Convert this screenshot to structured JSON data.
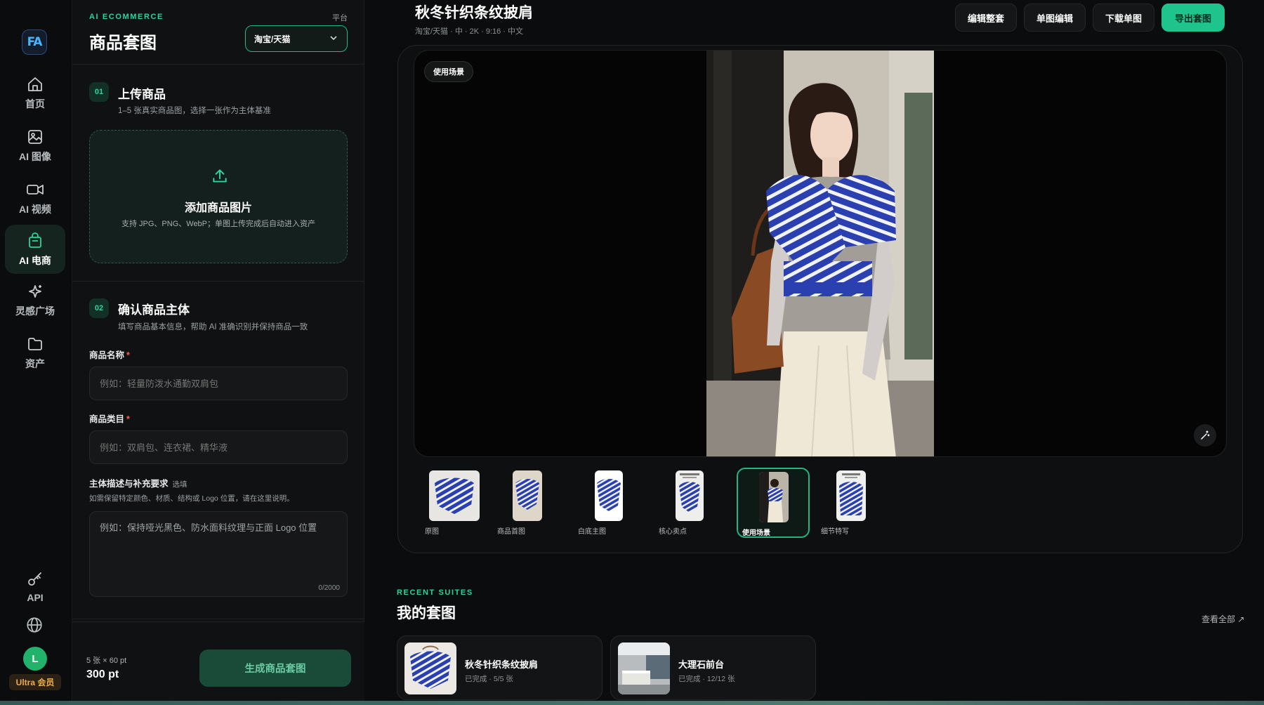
{
  "rail": {
    "items": [
      {
        "label": "首页",
        "icon": "home-icon"
      },
      {
        "label": "AI 图像",
        "icon": "image-icon"
      },
      {
        "label": "AI 视频",
        "icon": "video-icon"
      },
      {
        "label": "AI 电商",
        "icon": "shopping-bag-icon"
      },
      {
        "label": "灵感广场",
        "icon": "sparkles-icon"
      },
      {
        "label": "资产",
        "icon": "folder-icon"
      },
      {
        "label": "API",
        "icon": "key-icon"
      }
    ],
    "avatar_initial": "L",
    "membership": "Ultra 会员"
  },
  "panel": {
    "eyebrow": "AI ECOMMERCE",
    "title": "商品套图",
    "platform_label": "平台",
    "platform_value": "淘宝/天猫",
    "step1": {
      "num": "01",
      "title": "上传商品",
      "sub": "1–5 张真实商品图，选择一张作为主体基准",
      "drop_title": "添加商品图片",
      "drop_sub": "支持 JPG、PNG、WebP；单图上传完成后自动进入资产"
    },
    "step2": {
      "num": "02",
      "title": "确认商品主体",
      "sub": "填写商品基本信息，帮助 AI 准确识别并保持商品一致",
      "name_label": "商品名称",
      "name_placeholder": "例如：轻量防泼水通勤双肩包",
      "category_label": "商品类目",
      "category_placeholder": "例如：双肩包、连衣裙、精华液",
      "desc_label": "主体描述与补充要求",
      "desc_optional": "选填",
      "desc_hint": "如需保留特定颜色、材质、结构或 Logo 位置，请在这里说明。",
      "desc_placeholder": "例如：保持哑光黑色、防水面料纹理与正面 Logo 位置",
      "desc_count": "0/2000"
    },
    "footer": {
      "cost_sub": "5 张 × 60 pt",
      "cost_main": "300 pt",
      "generate": "生成商品套图"
    }
  },
  "main": {
    "title": "秋冬针织条纹披肩",
    "meta": "淘宝/天猫 · 中 · 2K · 9:16 · 中文",
    "buttons": {
      "edit_suite": "编辑整套",
      "edit_single": "单图编辑",
      "download_single": "下载单图",
      "export_suite": "导出套图"
    },
    "scene_tag": "使用场景",
    "thumbnails": [
      {
        "label": "原图"
      },
      {
        "label": "商品首图"
      },
      {
        "label": "白底主图"
      },
      {
        "label": "核心卖点"
      },
      {
        "label": "使用场景"
      },
      {
        "label": "细节特写"
      }
    ],
    "active_thumbnail": "使用场景"
  },
  "recent": {
    "eyebrow": "RECENT SUITES",
    "title": "我的套图",
    "view_all": "查看全部 ↗",
    "suites": [
      {
        "title": "秋冬针织条纹披肩",
        "status": "已完成 · 5/5 张"
      },
      {
        "title": "大理石前台",
        "status": "已完成 · 12/12 张"
      }
    ]
  },
  "colors": {
    "accent": "#27d69b",
    "primary_button": "#1fc48c",
    "background": "#0b0c0d",
    "stripe_blue": "#2a3fb0"
  }
}
